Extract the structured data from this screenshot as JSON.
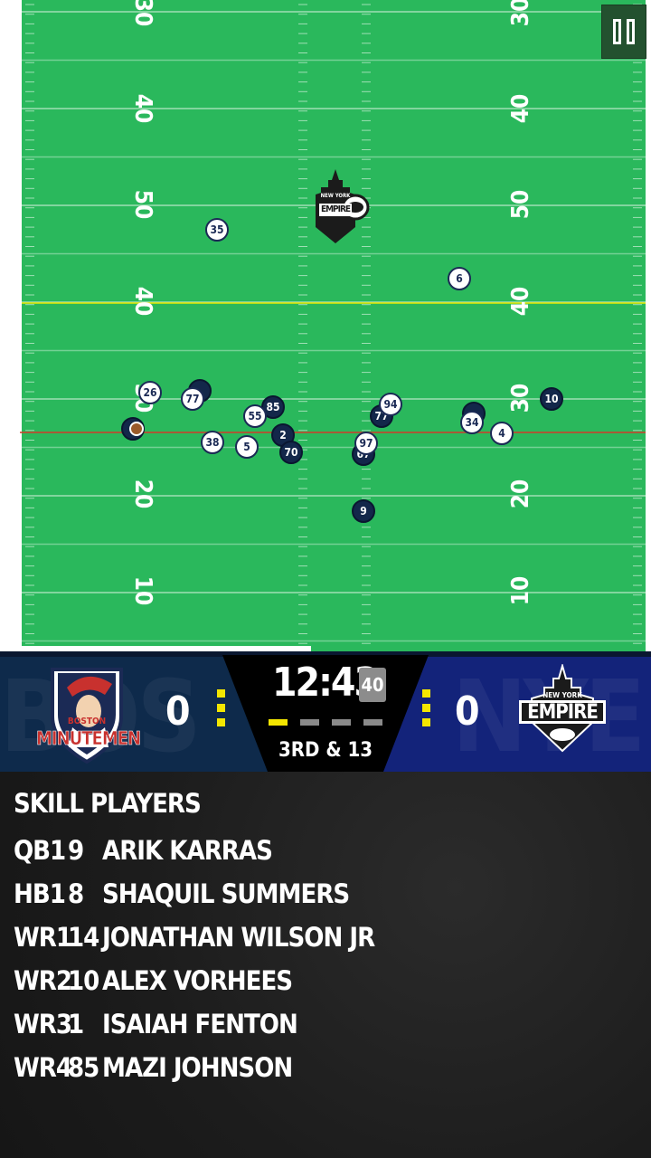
{
  "field": {
    "left_side_numbers": [
      "30",
      "40",
      "50",
      "40",
      "30",
      "20",
      "10"
    ],
    "right_side_numbers": [
      "30",
      "40",
      "50",
      "40",
      "30",
      "20",
      "10"
    ],
    "midfield_logo": {
      "top": "NEW YORK",
      "main": "EMPIRE"
    },
    "players": [
      {
        "team": "off",
        "number": "35"
      },
      {
        "team": "off",
        "number": "6"
      },
      {
        "team": "off",
        "number": "26"
      },
      {
        "team": "def",
        "number": ""
      },
      {
        "team": "off",
        "number": "77"
      },
      {
        "team": "def",
        "number": "85"
      },
      {
        "team": "off",
        "number": "55"
      },
      {
        "team": "def",
        "number": "2"
      },
      {
        "team": "def",
        "number": "70"
      },
      {
        "team": "off",
        "number": "38"
      },
      {
        "team": "off",
        "number": "5"
      },
      {
        "team": "def",
        "number": "77"
      },
      {
        "team": "off",
        "number": "94"
      },
      {
        "team": "def",
        "number": ""
      },
      {
        "team": "off",
        "number": "34"
      },
      {
        "team": "off",
        "number": "4"
      },
      {
        "team": "def",
        "number": "10"
      },
      {
        "team": "def",
        "number": "67"
      },
      {
        "team": "off",
        "number": "97"
      },
      {
        "team": "def",
        "number": "9"
      },
      {
        "team": "def",
        "number": ""
      }
    ]
  },
  "controls": {
    "pause_icon": "pause-icon"
  },
  "scoreboard": {
    "home": {
      "abbr": "BOS",
      "name_top": "BOSTON",
      "name_bottom": "MINUTEMEN",
      "score": "0",
      "color": "#0e2a4b"
    },
    "away": {
      "abbr": "NYE",
      "name_top": "NEW YORK",
      "name_bottom": "EMPIRE",
      "score": "0",
      "color": "#13237a"
    },
    "game_clock": "12:43",
    "play_clock": "40",
    "down_distance": "3RD & 13",
    "accent": "#f4e600"
  },
  "skill_players": {
    "title": "SKILL PLAYERS",
    "rows": [
      {
        "pos": "QB1",
        "num": "9",
        "name": "ARIK KARRAS"
      },
      {
        "pos": "HB1",
        "num": "8",
        "name": "SHAQUIL SUMMERS"
      },
      {
        "pos": "WR1",
        "num": "14",
        "name": "JONATHAN WILSON JR"
      },
      {
        "pos": "WR2",
        "num": "10",
        "name": "ALEX VORHEES"
      },
      {
        "pos": "WR3",
        "num": "1",
        "name": "ISAIAH FENTON"
      },
      {
        "pos": "WR4",
        "num": "85",
        "name": "MAZI JOHNSON"
      }
    ]
  }
}
